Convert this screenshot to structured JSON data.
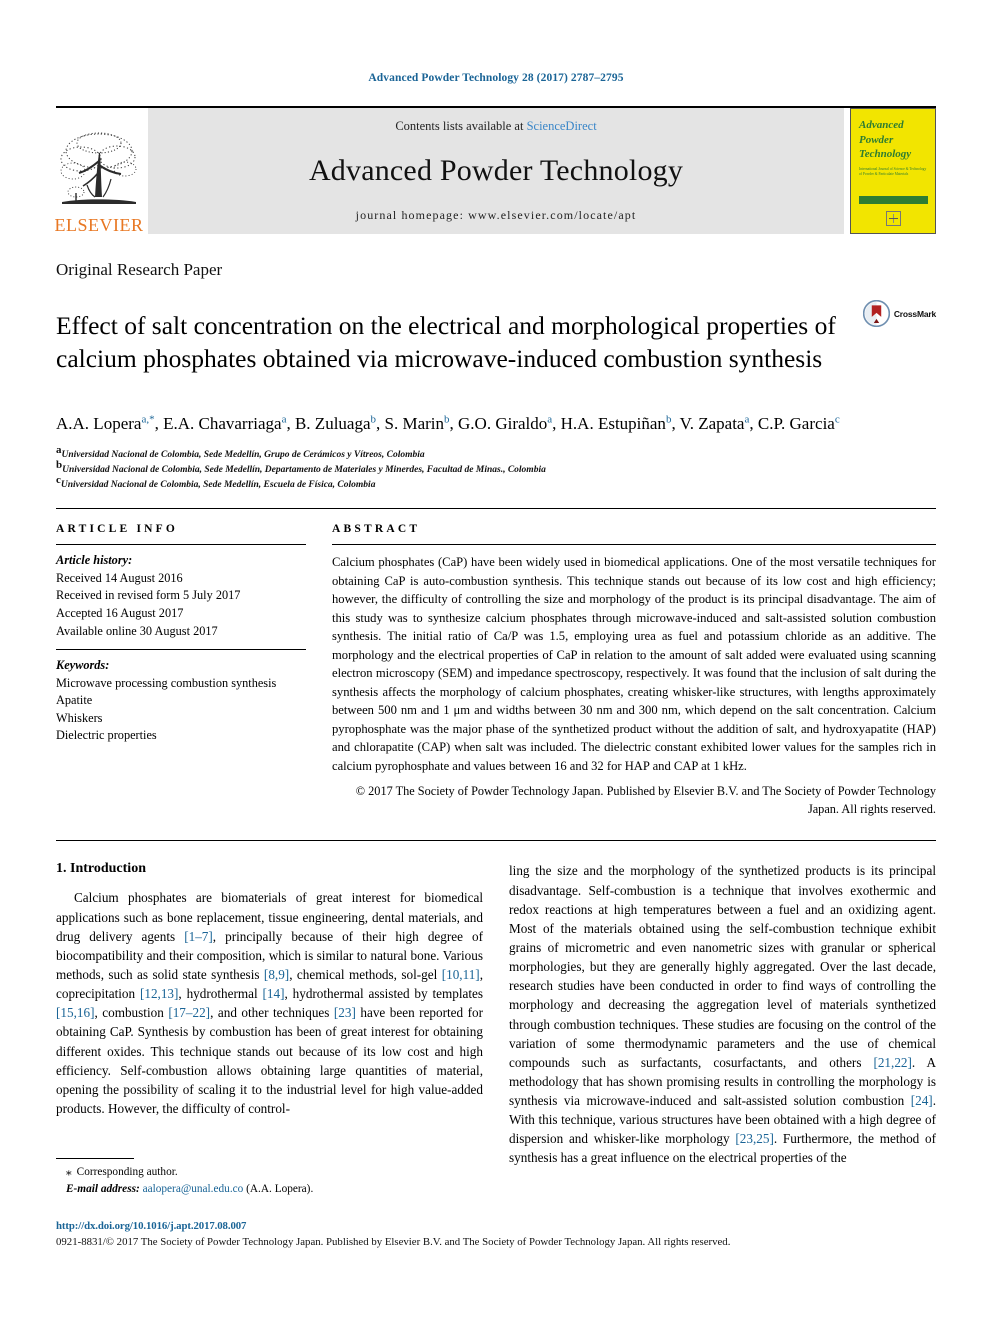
{
  "running_head": "Advanced Powder Technology 28 (2017) 2787–2795",
  "masthead": {
    "contents_prefix": "Contents lists available at ",
    "sciencedirect": "ScienceDirect",
    "journal_title": "Advanced Powder Technology",
    "homepage": "journal homepage: www.elsevier.com/locate/apt",
    "publisher_name": "ELSEVIER",
    "cover": {
      "line1": "Advanced",
      "line2": "Powder",
      "line3": "Technology",
      "subtitle": "International Journal of Science & Technology of Powder & Particulate Materials",
      "footer_mark": "ELSEVIER"
    }
  },
  "article_type": "Original Research Paper",
  "title": "Effect of salt concentration on the electrical and morphological properties of calcium phosphates obtained via microwave-induced combustion synthesis",
  "crossmark_label": "CrossMark",
  "authors": [
    {
      "name": "A.A. Lopera",
      "marks": "a,*"
    },
    {
      "name": "E.A. Chavarriaga",
      "marks": "a"
    },
    {
      "name": "B. Zuluaga",
      "marks": "b"
    },
    {
      "name": "S. Marin",
      "marks": "b"
    },
    {
      "name": "G.O. Giraldo",
      "marks": "a"
    },
    {
      "name": "H.A. Estupiñan",
      "marks": "b"
    },
    {
      "name": "V. Zapata",
      "marks": "a"
    },
    {
      "name": "C.P. Garcia",
      "marks": "c"
    }
  ],
  "affiliations": [
    {
      "mark": "a",
      "text": "Universidad Nacional de Colombia, Sede Medellín, Grupo de Cerámicos y Vítreos, Colombia"
    },
    {
      "mark": "b",
      "text": "Universidad Nacional de Colombia, Sede Medellín, Departamento de Materiales y Minerdes, Facultad de Minas., Colombia"
    },
    {
      "mark": "c",
      "text": "Universidad Nacional de Colombia, Sede Medellín, Escuela de Física, Colombia"
    }
  ],
  "article_info": {
    "heading": "ARTICLE INFO",
    "history_label": "Article history:",
    "history": [
      "Received 14 August 2016",
      "Received in revised form 5 July 2017",
      "Accepted 16 August 2017",
      "Available online 30 August 2017"
    ],
    "keywords_label": "Keywords:",
    "keywords": [
      "Microwave processing combustion synthesis",
      "Apatite",
      "Whiskers",
      "Dielectric properties"
    ]
  },
  "abstract": {
    "heading": "ABSTRACT",
    "body": "Calcium phosphates (CaP) have been widely used in biomedical applications. One of the most versatile techniques for obtaining CaP is auto-combustion synthesis. This technique stands out because of its low cost and high efficiency; however, the difficulty of controlling the size and morphology of the product is its principal disadvantage. The aim of this study was to synthesize calcium phosphates through microwave-induced and salt-assisted solution combustion synthesis. The initial ratio of Ca/P was 1.5, employing urea as fuel and potassium chloride as an additive. The morphology and the electrical properties of CaP in relation to the amount of salt added were evaluated using scanning electron microscopy (SEM) and impedance spectroscopy, respectively. It was found that the inclusion of salt during the synthesis affects the morphology of calcium phosphates, creating whisker-like structures, with lengths approximately between 500 nm and 1 μm and widths between 30 nm and 300 nm, which depend on the salt concentration. Calcium pyrophosphate was the major phase of the synthetized product without the addition of salt, and hydroxyapatite (HAP) and chlorapatite (CAP) when salt was included. The dielectric constant exhibited lower values for the samples rich in calcium pyrophosphate and values between 16 and 32 for HAP and CAP at 1 kHz.",
    "copyright": "© 2017 The Society of Powder Technology Japan. Published by Elsevier B.V. and The Society of Powder Technology Japan. All rights reserved."
  },
  "introduction": {
    "heading": "1. Introduction",
    "left_paragraph_1": "Calcium phosphates are biomaterials of great interest for biomedical applications such as bone replacement, tissue engineering, dental materials, and drug delivery agents [1–7], principally because of their high degree of biocompatibility and their composition, which is similar to natural bone. Various methods, such as solid state synthesis [8,9], chemical methods, sol-gel [10,11], coprecipitation [12,13], hydrothermal [14], hydrothermal assisted by templates [15,16], combustion [17–22], and other techniques [23] have been reported for obtaining CaP. Synthesis by combustion has been of great interest for obtaining different oxides. This technique stands out because of its low cost and high efficiency. Self-combustion allows obtaining large quantities of material, opening the possibility of scaling it to the industrial level for high value-added products. However, the difficulty of control-",
    "right_paragraph_1": "ling the size and the morphology of the synthetized products is its principal disadvantage. Self-combustion is a technique that involves exothermic and redox reactions at high temperatures between a fuel and an oxidizing agent. Most of the materials obtained using the self-combustion technique exhibit grains of micrometric and even nanometric sizes with granular or spherical morphologies, but they are generally highly aggregated. Over the last decade, research studies have been conducted in order to find ways of controlling the morphology and decreasing the aggregation level of materials synthetized through combustion techniques. These studies are focusing on the control of the variation of some thermodynamic parameters and the use of chemical compounds such as surfactants, cosurfactants, and others [21,22]. A methodology that has shown promising results in controlling the morphology is synthesis via microwave-induced and salt-assisted solution combustion [24]. With this technique, various structures have been obtained with a high degree of dispersion and whisker-like morphology [23,25]. Furthermore, the method of synthesis has a great influence on the electrical properties of the"
  },
  "footnote": {
    "corresponding": "Corresponding author.",
    "email_label": "E-mail address:",
    "email": "aalopera@unal.edu.co",
    "email_suffix": "(A.A. Lopera)."
  },
  "page_footer": {
    "doi": "http://dx.doi.org/10.1016/j.apt.2017.08.007",
    "issn_line": "0921-8831/© 2017 The Society of Powder Technology Japan. Published by Elsevier B.V. and The Society of Powder Technology Japan. All rights reserved."
  },
  "colors": {
    "link": "#1a6496",
    "elsevier_orange": "#e87722",
    "cover_yellow": "#f2e500",
    "cover_green": "#2e7d32",
    "band_gray": "#e4e4e4"
  }
}
